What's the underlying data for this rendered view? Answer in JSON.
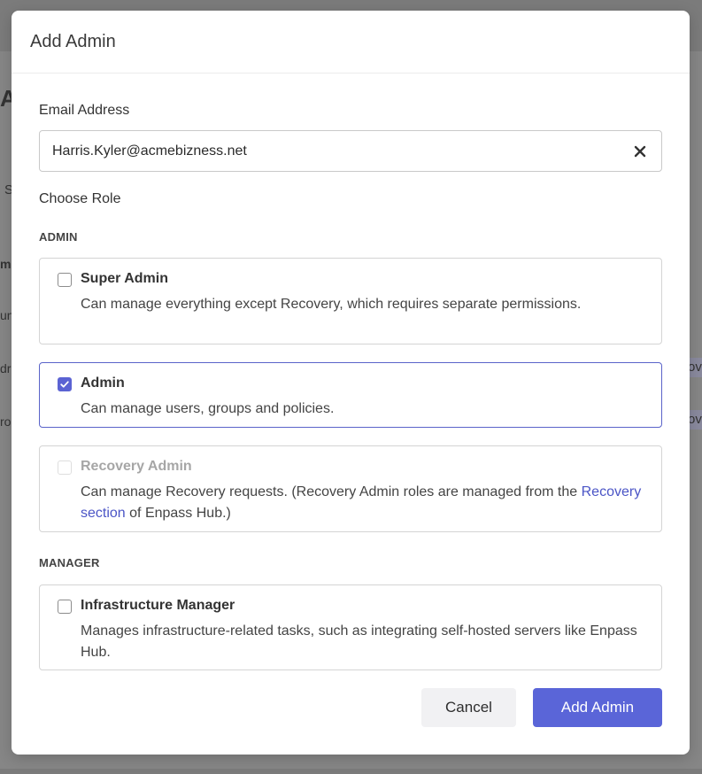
{
  "background": {
    "fragments": [
      "A",
      "S",
      "me",
      "un",
      "dre",
      "ro"
    ],
    "pill_text": "ov"
  },
  "modal": {
    "title": "Add Admin",
    "email": {
      "label": "Email Address",
      "value": "Harris.Kyler@acmebizness.net"
    },
    "choose_role_label": "Choose Role",
    "sections": {
      "admin_label": "ADMIN",
      "manager_label": "MANAGER"
    },
    "roles": {
      "super_admin": {
        "name": "Super Admin",
        "description": "Can manage everything except Recovery, which requires separate permissions.",
        "checked": false
      },
      "admin": {
        "name": "Admin",
        "description": "Can manage users, groups and policies.",
        "checked": true
      },
      "recovery_admin": {
        "name": "Recovery Admin",
        "description_prefix": "Can manage Recovery requests. (Recovery Admin roles are managed from the ",
        "link_text": "Recovery section",
        "description_suffix": " of Enpass Hub.)",
        "disabled": true
      },
      "infrastructure_manager": {
        "name": "Infrastructure Manager",
        "description": "Manages infrastructure-related tasks, such as integrating self-hosted servers like Enpass Hub.",
        "checked": false
      }
    },
    "buttons": {
      "cancel": "Cancel",
      "add": "Add Admin"
    },
    "colors": {
      "accent": "#5a65d8",
      "selected_border": "#5a63c9",
      "link": "#4b55c6"
    }
  }
}
